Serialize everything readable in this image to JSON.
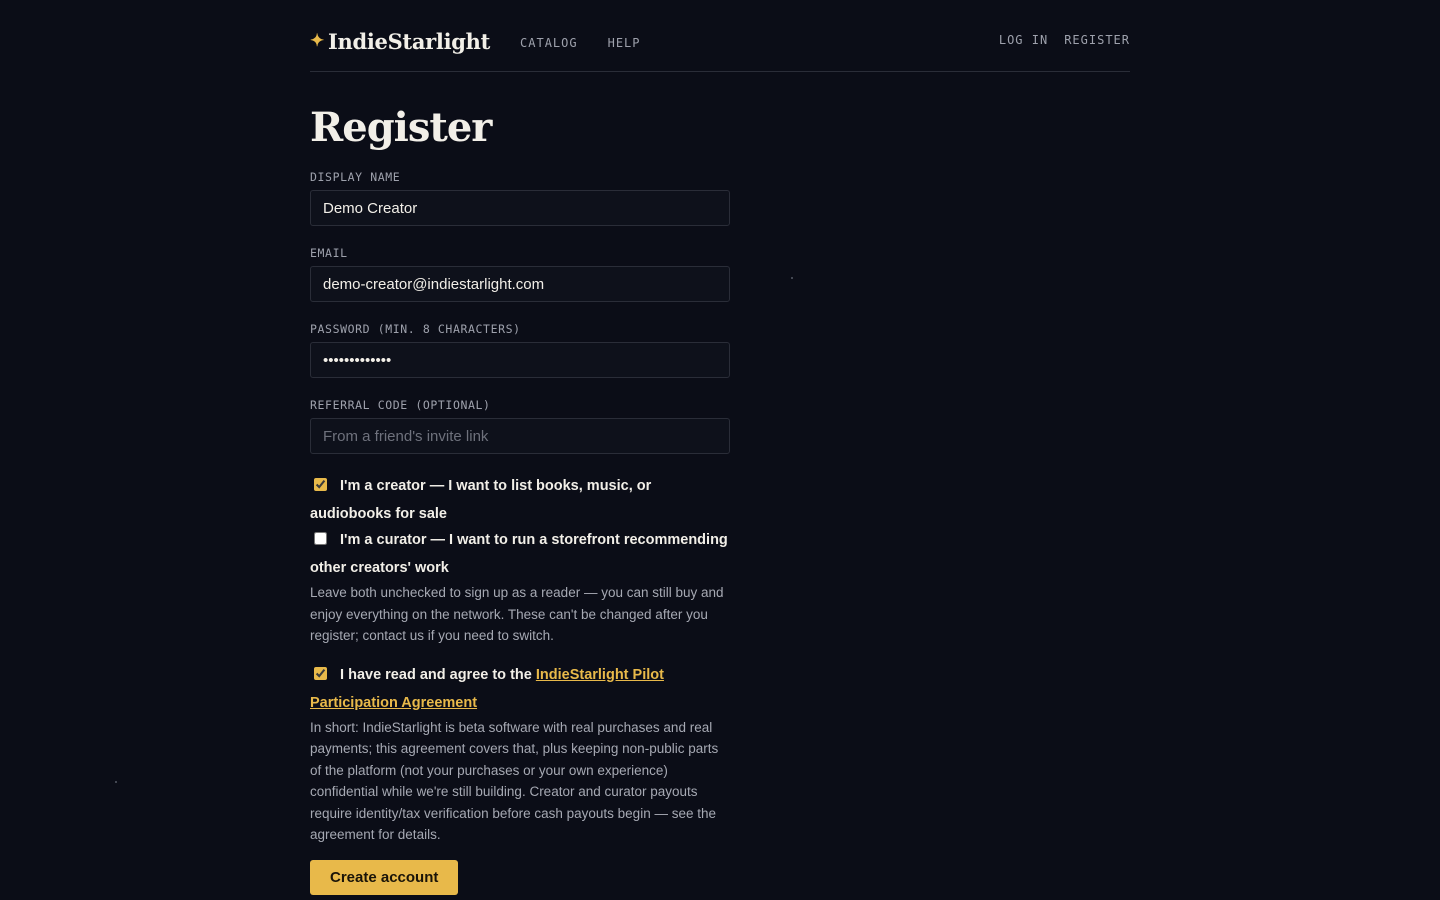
{
  "brand": {
    "name": "IndieStarlight",
    "star_glyph": "✦",
    "accent_color": "#e8b94a"
  },
  "nav": {
    "items": [
      "CATALOG",
      "HELP"
    ],
    "auth": [
      "LOG IN",
      "REGISTER"
    ]
  },
  "page": {
    "title": "Register"
  },
  "form": {
    "display_name": {
      "label": "DISPLAY NAME",
      "value": "Demo Creator",
      "placeholder": ""
    },
    "email": {
      "label": "EMAIL",
      "value": "demo-creator@indiestarlight.com",
      "placeholder": ""
    },
    "password": {
      "label": "PASSWORD (MIN. 8 CHARACTERS)",
      "value": "•••••••••••••"
    },
    "referral": {
      "label": "REFERRAL CODE (OPTIONAL)",
      "value": "",
      "placeholder": "From a friend's invite link"
    },
    "creator_check": {
      "label": "I'm a creator — I want to list books, music, or audiobooks for sale",
      "checked": true
    },
    "curator_check": {
      "label": "I'm a curator — I want to run a storefront recommending other creators' work",
      "checked": false
    },
    "role_help": "Leave both unchecked to sign up as a reader — you can still buy and enjoy everything on the network. These can't be changed after you register; contact us if you need to switch.",
    "agree_check": {
      "label_prefix": "I have read and agree to the ",
      "link_text": "IndieStarlight Pilot Participation Agreement",
      "checked": true
    },
    "terms_help": "In short: IndieStarlight is beta software with real purchases and real payments; this agreement covers that, plus keeping non-public parts of the platform (not your purchases or your own experience) confidential while we're still building. Creator and curator payouts require identity/tax verification before cash payouts begin — see the agreement for details.",
    "submit_label": "Create account"
  }
}
